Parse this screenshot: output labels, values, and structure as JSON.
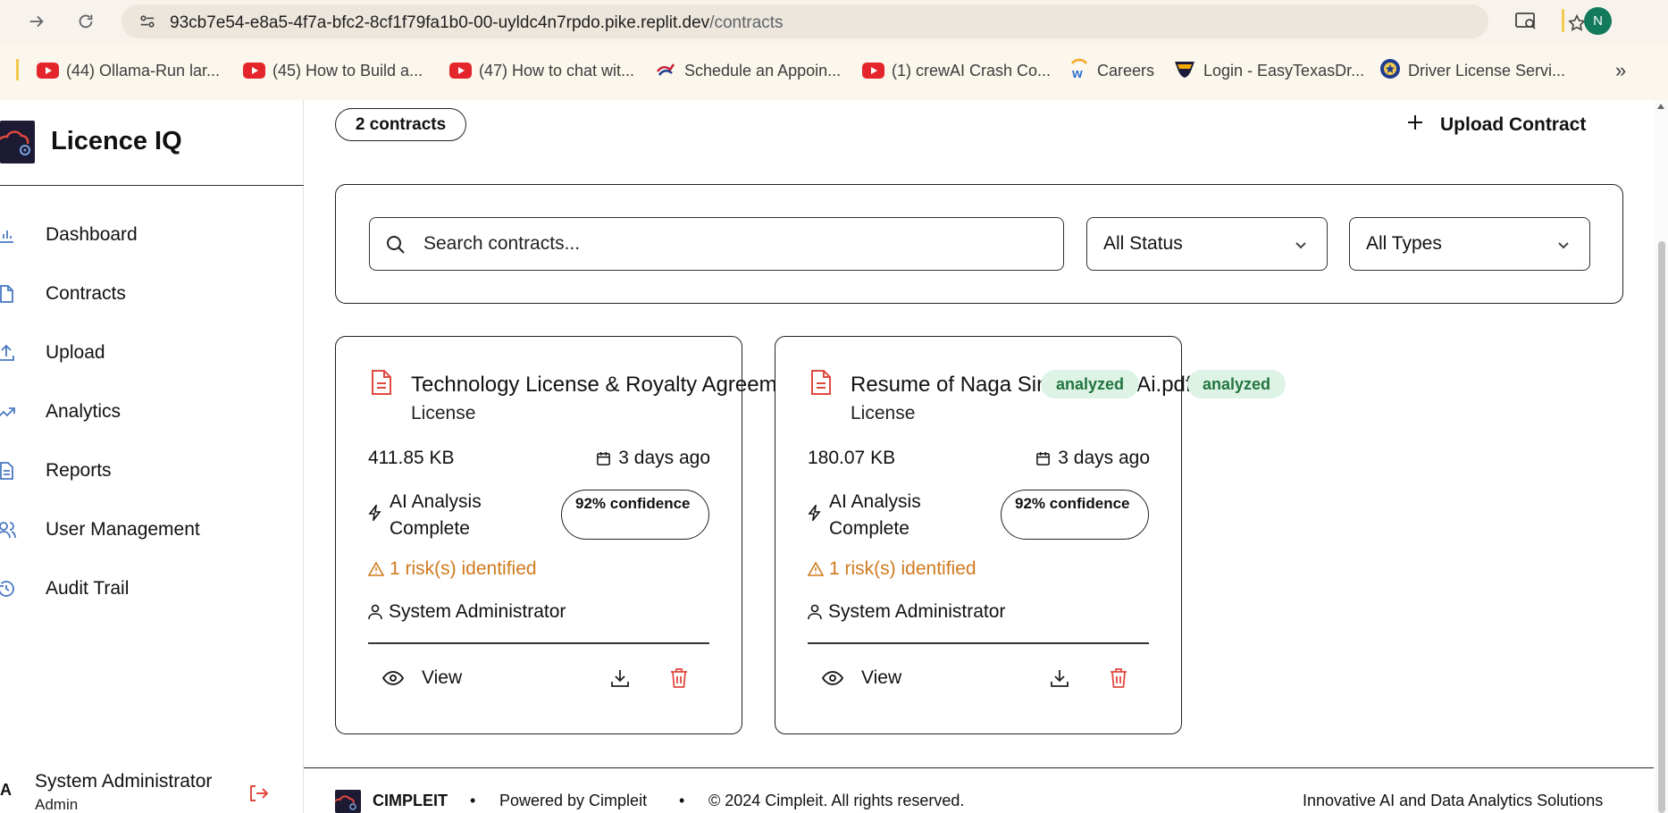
{
  "browser": {
    "url_host": "93cb7e54-e8a5-4f7a-bfc2-8cf1f79fa1b0-00-uyldc4n7rpdo.pike.replit.dev",
    "url_path": "/contracts",
    "profile_initial": "N",
    "bookmarks": [
      {
        "label": "(44) Ollama-Run lar...",
        "icon": "youtube-icon"
      },
      {
        "label": "(45) How to Build a...",
        "icon": "youtube-icon"
      },
      {
        "label": "(47) How to chat wit...",
        "icon": "youtube-icon"
      },
      {
        "label": "Schedule an Appoin...",
        "icon": "flag-icon"
      },
      {
        "label": "(1) crewAI Crash Co...",
        "icon": "youtube-icon"
      },
      {
        "label": "Careers",
        "icon": "workday-icon"
      },
      {
        "label": "Login - EasyTexasDr...",
        "icon": "shield-icon"
      },
      {
        "label": "Driver License Servi...",
        "icon": "seal-icon"
      }
    ],
    "more_bookmarks": "»"
  },
  "sidebar": {
    "brand": "Licence IQ",
    "items": [
      {
        "label": "Dashboard",
        "icon": "bar-chart-icon"
      },
      {
        "label": "Contracts",
        "icon": "file-icon"
      },
      {
        "label": "Upload",
        "icon": "upload-icon"
      },
      {
        "label": "Analytics",
        "icon": "trending-up-icon"
      },
      {
        "label": "Reports",
        "icon": "report-icon"
      },
      {
        "label": "User Management",
        "icon": "users-icon"
      },
      {
        "label": "Audit Trail",
        "icon": "history-icon"
      }
    ],
    "user": {
      "initial": "A",
      "name": "System Administrator",
      "role": "Admin"
    }
  },
  "main": {
    "count": "2 contracts",
    "upload_label": "Upload Contract",
    "search_placeholder": "Search contracts...",
    "status_filter": "All Status",
    "type_filter": "All Types",
    "contracts": [
      {
        "title": "Technology License & Royalty Agreement - Manufacturing.pdf",
        "type": "License",
        "status": "analyzed",
        "size": "411.85 KB",
        "date": "3 days ago",
        "analysis": "AI Analysis Complete",
        "confidence": "92% confidence",
        "risk": "1 risk(s) identified",
        "owner": "System Administrator",
        "view_label": "View"
      },
      {
        "title": "Resume of Naga Sindhu Rao-Ai.pdf",
        "type": "License",
        "status": "analyzed",
        "size": "180.07 KB",
        "date": "3 days ago",
        "analysis": "AI Analysis Complete",
        "confidence": "92% confidence",
        "risk": "1 risk(s) identified",
        "owner": "System Administrator",
        "view_label": "View"
      }
    ]
  },
  "footer": {
    "brand": "CIMPLEIT",
    "powered": "Powered by Cimpleit",
    "copyright": "© 2024 Cimpleit. All rights reserved.",
    "tagline": "Innovative AI and Data Analytics Solutions",
    "separator": "•"
  },
  "colors": {
    "accent_red": "#e0493f",
    "risk_orange": "#d07a1e",
    "badge_green_bg": "#dcf3e5",
    "badge_green_text": "#22753f",
    "nav_icon_blue": "#4a78c2"
  }
}
